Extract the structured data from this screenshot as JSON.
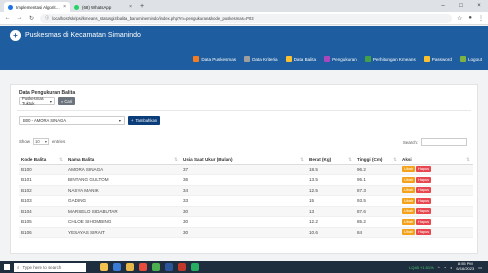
{
  "browser": {
    "tabs": [
      {
        "title": "Implementasi Algoritma K-Mea",
        "close": "×",
        "active": true
      },
      {
        "title": "(68) WhatsApp",
        "close": "×",
        "active": false
      }
    ],
    "new_tab": "+",
    "url": "localhost/skripsi/kmeans_statusgizibalita_baruminemindo/index.php?m=pengukuran&kode_puskesmas=P03",
    "window": {
      "minimize": "–",
      "maximize": "□",
      "close": "×"
    }
  },
  "app": {
    "title": "Puskesmas di Kecamatan Simanindo",
    "nav": [
      {
        "label": "Data Puskesmas",
        "color": "#f57c20"
      },
      {
        "label": "Data Kriteria",
        "color": "#9e9e9e"
      },
      {
        "label": "Data Balita",
        "color": "#fbc02d"
      },
      {
        "label": "Pengukuran",
        "color": "#ab47bc"
      },
      {
        "label": "Perhitungan Kmeans",
        "color": "#43a047"
      },
      {
        "label": "Password",
        "color": "#fbc02d"
      },
      {
        "label": "Logout",
        "color": "#7cb342"
      }
    ]
  },
  "content": {
    "section_title": "Data Pengukuran Balita",
    "puskesmas_select": "Puskesmas Tuktuk",
    "cari_label": "Cari",
    "balita_select": "B00 - AMORA SINAGA",
    "tambah_label": "Tambahkan",
    "show_label": "Show",
    "page_length": "10",
    "entries_label": "entries",
    "search_label": "Search:"
  },
  "table": {
    "columns": [
      "Kode Balita",
      "Nama Balita",
      "Usia Saat Ukur (Bulan)",
      "Berat (Kg)",
      "Tinggi (Cm)",
      "Aksi"
    ],
    "ubah_label": "Ubah",
    "hapus_label": "Hapus",
    "rows": [
      [
        "B100",
        "AMORA SINAGA",
        "37",
        "18.5",
        "96.2"
      ],
      [
        "B101",
        "BINTANG GULTOM",
        "36",
        "13.5",
        "95.1"
      ],
      [
        "B102",
        "NASYA MANIK",
        "34",
        "12.5",
        "87.3"
      ],
      [
        "B103",
        "GADING",
        "33",
        "15",
        "93.5"
      ],
      [
        "B104",
        "MARSELO SIDABUTAR",
        "30",
        "13",
        "87.6"
      ],
      [
        "B105",
        "CHLOE SIHOMBING",
        "30",
        "12.2",
        "85.2"
      ],
      [
        "B106",
        "YESAYAS SIRAIT",
        "30",
        "10.6",
        "84"
      ]
    ]
  },
  "taskbar": {
    "search_placeholder": "Type here to search",
    "ihsg": "LQ45 +1.51%",
    "time": "8:55 PM",
    "date": "6/16/2023"
  }
}
